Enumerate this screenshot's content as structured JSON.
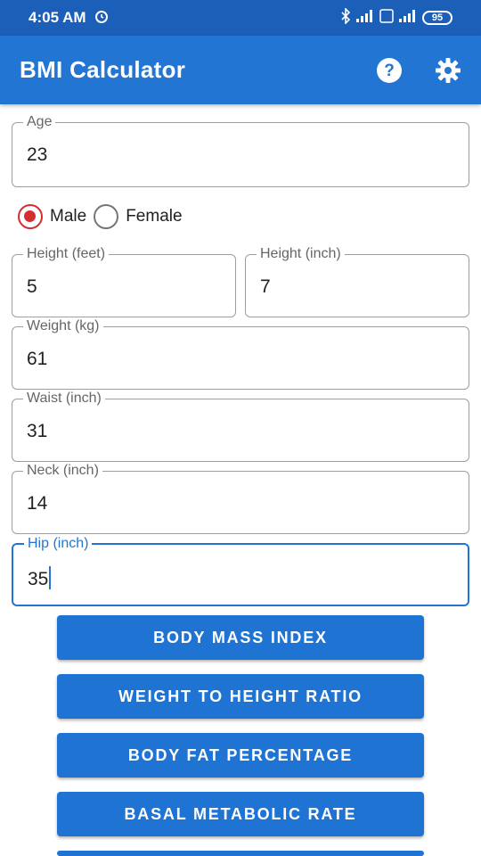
{
  "status_bar": {
    "time": "4:05 AM",
    "battery": "95"
  },
  "app_bar": {
    "title": "BMI Calculator"
  },
  "form": {
    "age": {
      "label": "Age",
      "value": "23"
    },
    "gender": {
      "male": "Male",
      "female": "Female",
      "selected": "Male"
    },
    "height_feet": {
      "label": "Height (feet)",
      "value": "5"
    },
    "height_inch": {
      "label": "Height (inch)",
      "value": "7"
    },
    "weight": {
      "label": "Weight (kg)",
      "value": "61"
    },
    "waist": {
      "label": "Waist (inch)",
      "value": "31"
    },
    "neck": {
      "label": "Neck (inch)",
      "value": "14"
    },
    "hip": {
      "label": "Hip (inch)",
      "value": "35"
    }
  },
  "buttons": {
    "bmi": "BODY MASS INDEX",
    "whr": "WEIGHT TO HEIGHT RATIO",
    "bfp": "BODY FAT PERCENTAGE",
    "bmr": "BASAL METABOLIC RATE"
  },
  "colors": {
    "primary": "#2375d4",
    "status_bar": "#1c5fb8",
    "radio_checked": "#d32f2f"
  }
}
